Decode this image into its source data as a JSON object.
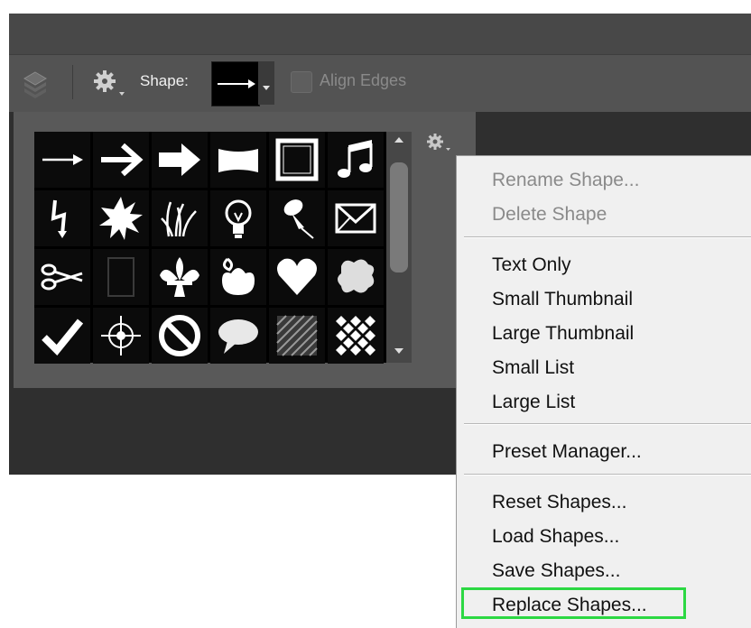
{
  "options_bar": {
    "shape_label": "Shape:",
    "align_edges_label": "Align Edges",
    "align_edges_checked": false
  },
  "icons": {
    "layers": "layers-icon",
    "gear": "gear-icon",
    "panel_gear": "gear-icon"
  },
  "shapes": [
    "arrow-thin",
    "arrow-bold",
    "arrow-block",
    "banner",
    "frame",
    "music-note",
    "lightning",
    "starburst",
    "grass",
    "lightbulb",
    "pushpin",
    "envelope",
    "scissors",
    "blank-frame",
    "fleur-de-lis",
    "ornament",
    "heart",
    "puzzle-splat",
    "checkmark",
    "target",
    "no-symbol",
    "speech-bubble",
    "hatch-square",
    "checkerboard"
  ],
  "menu": {
    "items": [
      {
        "label": "Rename Shape...",
        "enabled": false
      },
      {
        "label": "Delete Shape",
        "enabled": false
      },
      {
        "label": "Text Only",
        "enabled": true
      },
      {
        "label": "Small Thumbnail",
        "enabled": true
      },
      {
        "label": "Large Thumbnail",
        "enabled": true
      },
      {
        "label": "Small List",
        "enabled": true
      },
      {
        "label": "Large List",
        "enabled": true
      },
      {
        "label": "Preset Manager...",
        "enabled": true
      },
      {
        "label": "Reset Shapes...",
        "enabled": true
      },
      {
        "label": "Load Shapes...",
        "enabled": true
      },
      {
        "label": "Save Shapes...",
        "enabled": true
      },
      {
        "label": "Replace Shapes...",
        "enabled": true,
        "highlighted": true
      }
    ]
  },
  "colors": {
    "highlight": "#2cd843",
    "toolbar": "#535353",
    "panel": "#595959"
  }
}
